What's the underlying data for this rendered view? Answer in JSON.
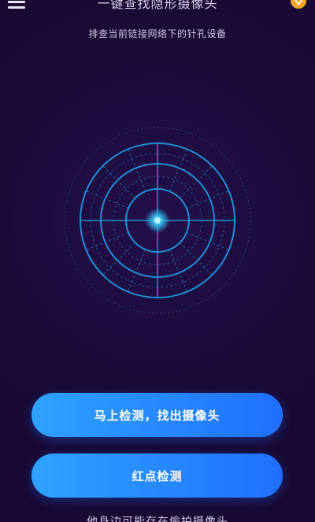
{
  "header": {
    "title": "一键查找隐形摄像头",
    "subtitle": "排查当前链接网络下的针孔设备",
    "menu_icon": "menu-icon",
    "vip_icon": "diamond-icon"
  },
  "radar": {
    "icon": "radar-scanner",
    "accent_color": "#1f8fd6",
    "center_color": "#39d0ff"
  },
  "buttons": {
    "detect_label": "马上检测，找出摄像头",
    "red_dot_label": "红点检测"
  },
  "footer": {
    "note": "他身边可能存在偷拍摄像头"
  },
  "colors": {
    "background": "#1b0a38",
    "button_gradient_start": "#2ea3ff",
    "button_gradient_end": "#1f6fff",
    "vip_badge": "#f5a623"
  }
}
